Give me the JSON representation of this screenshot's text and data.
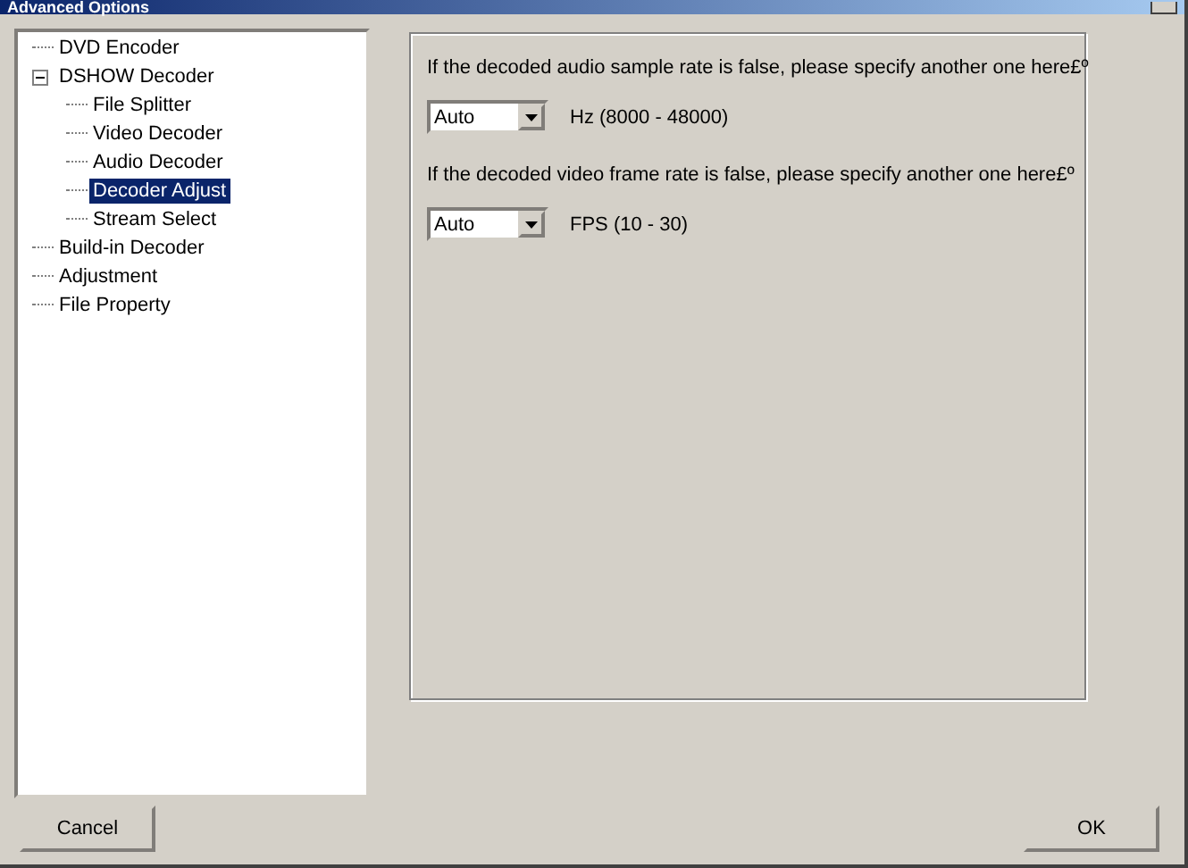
{
  "window": {
    "title": "Advanced Options"
  },
  "tree": [
    {
      "label": "DVD Encoder",
      "selected": false
    },
    {
      "label": "DSHOW Decoder",
      "selected": false,
      "expanded": true,
      "children": [
        {
          "label": "File Splitter",
          "selected": false
        },
        {
          "label": "Video Decoder",
          "selected": false
        },
        {
          "label": "Audio Decoder",
          "selected": false
        },
        {
          "label": "Decoder Adjust",
          "selected": true
        },
        {
          "label": "Stream Select",
          "selected": false
        }
      ]
    },
    {
      "label": "Build-in Decoder",
      "selected": false
    },
    {
      "label": "Adjustment",
      "selected": false
    },
    {
      "label": "File Property",
      "selected": false
    }
  ],
  "settings": [
    {
      "prompt": "If the decoded audio sample rate is false, please specify another one here£º",
      "value": "Auto",
      "range": "Hz (8000 - 48000)"
    },
    {
      "prompt": "If the decoded video frame rate is false, please specify another one here£º",
      "value": "Auto",
      "range": "FPS (10 - 30)"
    }
  ],
  "buttons": [
    "Cancel",
    "OK"
  ]
}
